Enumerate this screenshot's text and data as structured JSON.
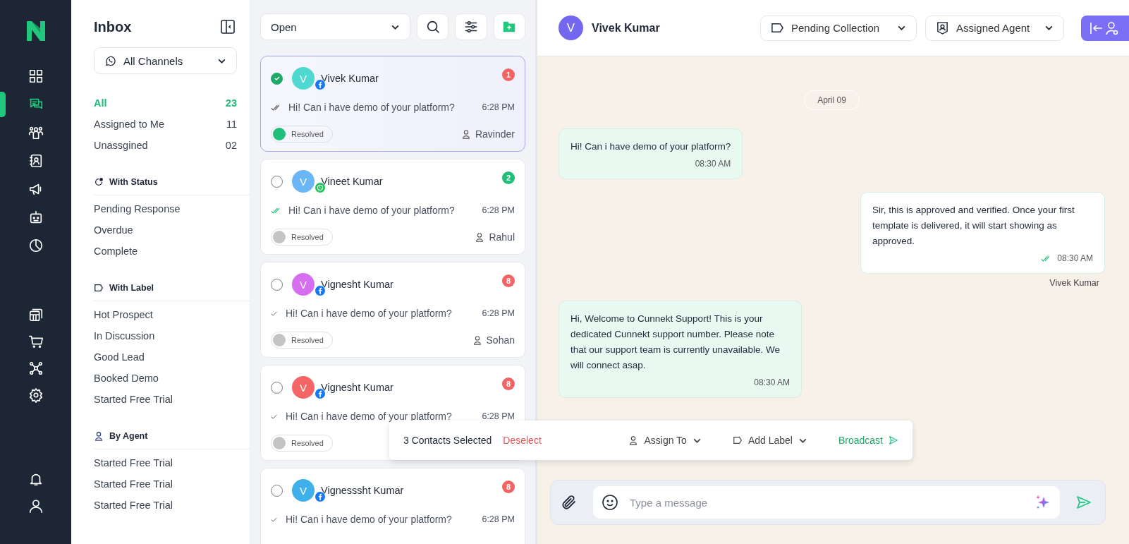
{
  "nav": {
    "main": [
      {
        "selected": false
      },
      {
        "selected": true
      },
      {
        "selected": false
      },
      {
        "selected": false
      },
      {
        "selected": false
      },
      {
        "selected": false
      },
      {
        "selected": false
      }
    ],
    "tools": [
      {
        "selected": false
      },
      {
        "selected": false
      },
      {
        "selected": false
      },
      {
        "selected": false
      }
    ],
    "footer": [
      {
        "selected": false
      },
      {
        "selected": false
      }
    ]
  },
  "sidebar": {
    "title": "Inbox",
    "channel_select": "All Channels",
    "filters": [
      {
        "label": "All",
        "count": "23",
        "selected": true
      },
      {
        "label": "Assigned to Me",
        "count": "11",
        "selected": false
      },
      {
        "label": "Unassgined",
        "count": "02",
        "selected": false
      }
    ],
    "sections": [
      {
        "kind": "status",
        "title": "With Status",
        "items": [
          "Pending Response",
          "Overdue",
          "Complete"
        ]
      },
      {
        "kind": "label",
        "title": "With Label",
        "items": [
          "Hot Prospect",
          "In Discussion",
          "Good Lead",
          "Booked Demo",
          "Started Free Trial"
        ]
      },
      {
        "kind": "agent",
        "title": "By Agent",
        "items": [
          "Started Free Trial",
          "Started Free Trial",
          "Started Free Trial"
        ]
      }
    ]
  },
  "list": {
    "status_select": "Open",
    "conversations": [
      {
        "name": "Vivek Kumar",
        "avatar": {
          "letter": "V",
          "color": "#4fd8cf"
        },
        "channel": {
          "kind": "facebook"
        },
        "unread": {
          "count": "1",
          "color": "#f26363"
        },
        "ticks": {
          "kind": "double",
          "read": false
        },
        "message": "Hi! Can i have demo of your platform?",
        "time": "6:28 PM",
        "status": "Resolved",
        "resolved": true,
        "agent": "Ravinder",
        "selected": true
      },
      {
        "name": "Vineet Kumar",
        "avatar": {
          "letter": "V",
          "color": "#6bb6f5"
        },
        "channel": {
          "kind": "whatsapp"
        },
        "unread": {
          "count": "2",
          "color": "#1fbf7a"
        },
        "ticks": {
          "kind": "double",
          "read": true
        },
        "message": "Hi! Can i have demo of your platform?",
        "time": "6:28 PM",
        "status": "Resolved",
        "resolved": false,
        "agent": "Rahul",
        "selected": false
      },
      {
        "name": "Vignesht Kumar",
        "avatar": {
          "letter": "V",
          "color": "#d66ef0"
        },
        "channel": {
          "kind": "facebook"
        },
        "unread": {
          "count": "8",
          "color": "#f26363"
        },
        "ticks": {
          "kind": "single",
          "read": false
        },
        "message": "Hi! Can i have demo of your platform?",
        "time": "6:28 PM",
        "status": "Resolved",
        "resolved": false,
        "agent": "Sohan",
        "selected": false
      },
      {
        "name": "Vignesht Kumar",
        "avatar": {
          "letter": "V",
          "color": "#f56565"
        },
        "channel": {
          "kind": "facebook"
        },
        "unread": {
          "count": "8",
          "color": "#f26363"
        },
        "ticks": {
          "kind": "single",
          "read": false
        },
        "message": "Hi! Can i have demo of your platform?",
        "time": "6:28 PM",
        "status": "Resolved",
        "resolved": false,
        "selected": false
      },
      {
        "name": "Vignesssht Kumar",
        "avatar": {
          "letter": "V",
          "color": "#3fb0ea"
        },
        "channel": {
          "kind": "facebook"
        },
        "unread": {
          "count": "8",
          "color": "#f26363"
        },
        "ticks": {
          "kind": "single",
          "read": false
        },
        "message": "Hi! Can i have demo of your platform?",
        "time": "6:28 PM",
        "selected": false
      }
    ]
  },
  "chat": {
    "contact": {
      "name": "Vivek Kumar",
      "avatar": "V"
    },
    "label_select": "Pending Collection",
    "agent_select": "Assigned Agent",
    "date": "April 09",
    "messages": [
      {
        "kind": "incoming",
        "text": "Hi! Can i have demo of your platform?",
        "time": "08:30 AM"
      },
      {
        "kind": "outgoing",
        "text": "Sir, this is approved and verified. Once your first template is delivered, it will start showing as approved.",
        "time": "08:30 AM",
        "sender": "Vivek Kumar"
      },
      {
        "kind": "incoming",
        "text": "Hi, Welcome to Cunnekt Support! This is your dedicated Cunnekt support number. Please note that our support team is currently unavailable. We will connect asap.",
        "time": "08:30 AM"
      }
    ],
    "composer": {
      "placeholder": "Type a message"
    }
  },
  "selection_bar": {
    "count_text": "3 Contacts Selected",
    "deselect": "Deselect",
    "assign": "Assign To",
    "label": "Add Label",
    "broadcast": "Broadcast"
  }
}
